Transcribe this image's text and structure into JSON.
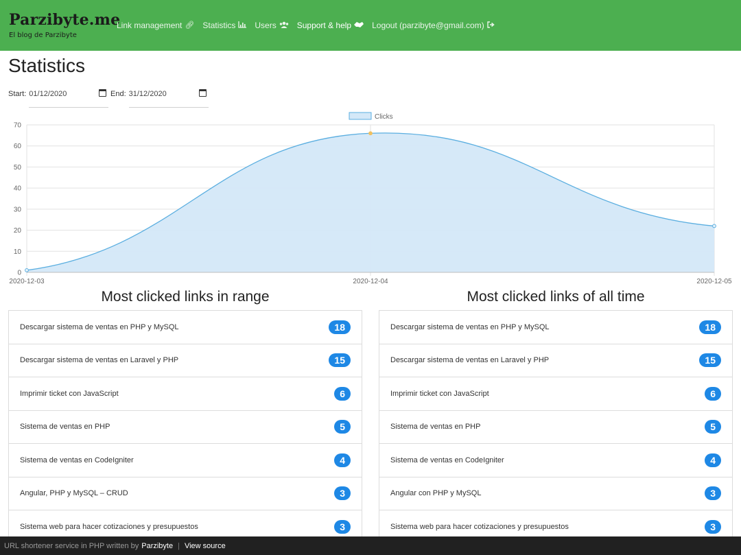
{
  "brand": {
    "name": "Parzibyte.me",
    "tagline": "El blog de Parzibyte"
  },
  "nav": {
    "items": [
      {
        "label": "Link management",
        "icon": "link-icon"
      },
      {
        "label": "Statistics",
        "icon": "chart-icon"
      },
      {
        "label": "Users",
        "icon": "users-icon"
      },
      {
        "label": "Support & help",
        "icon": "handshake-icon"
      },
      {
        "label": "Logout (parzibyte@gmail.com)",
        "icon": "sign-out-icon"
      }
    ]
  },
  "page": {
    "title": "Statistics"
  },
  "filters": {
    "start_label": "Start:",
    "start_value": "01/12/2020",
    "end_label": "End:",
    "end_value": "31/12/2020"
  },
  "chart_data": {
    "type": "area",
    "x": [
      "2020-12-03",
      "2020-12-04",
      "2020-12-05"
    ],
    "series": [
      {
        "name": "Clicks",
        "values": [
          1,
          66,
          22
        ]
      }
    ],
    "ylim": [
      0,
      70
    ],
    "yticks": [
      0,
      10,
      20,
      30,
      40,
      50,
      60,
      70
    ],
    "grid": true,
    "legend": "top-center",
    "colors": {
      "line": "#5aaee0",
      "fill": "#d4e8f8",
      "highlight_point": "#f0c060"
    }
  },
  "panels": {
    "range": {
      "title": "Most clicked links in range",
      "items": [
        {
          "label": "Descargar sistema de ventas en PHP y MySQL",
          "count": "18"
        },
        {
          "label": "Descargar sistema de ventas en Laravel y PHP",
          "count": "15"
        },
        {
          "label": "Imprimir ticket con JavaScript",
          "count": "6"
        },
        {
          "label": "Sistema de ventas en PHP",
          "count": "5"
        },
        {
          "label": "Sistema de ventas en CodeIgniter",
          "count": "4"
        },
        {
          "label": "Angular, PHP y MySQL – CRUD",
          "count": "3"
        },
        {
          "label": "Sistema web para hacer cotizaciones y presupuestos",
          "count": "3"
        }
      ]
    },
    "all_time": {
      "title": "Most clicked links of all time",
      "items": [
        {
          "label": "Descargar sistema de ventas en PHP y MySQL",
          "count": "18"
        },
        {
          "label": "Descargar sistema de ventas en Laravel y PHP",
          "count": "15"
        },
        {
          "label": "Imprimir ticket con JavaScript",
          "count": "6"
        },
        {
          "label": "Sistema de ventas en PHP",
          "count": "5"
        },
        {
          "label": "Sistema de ventas en CodeIgniter",
          "count": "4"
        },
        {
          "label": "Angular con PHP y MySQL",
          "count": "3"
        },
        {
          "label": "Sistema web para hacer cotizaciones y presupuestos",
          "count": "3"
        }
      ]
    }
  },
  "footer": {
    "text": "URL shortener service in PHP written by",
    "author_link": "Parzibyte",
    "separator": "|",
    "source_link": "View source"
  },
  "colors": {
    "navbar": "#4caf50",
    "badge": "#1e88e5",
    "footer": "#212121"
  }
}
